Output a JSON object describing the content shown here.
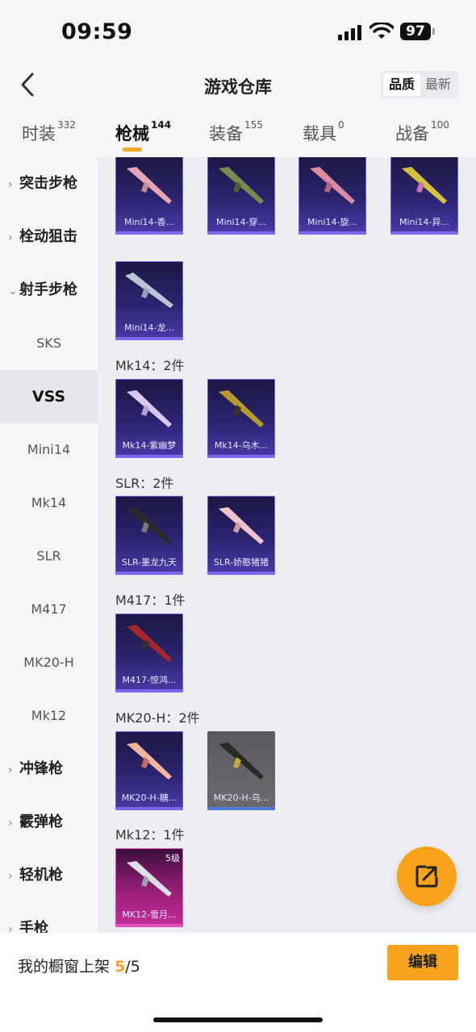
{
  "status_bar": {
    "time": "09:59",
    "battery": "97"
  },
  "header": {
    "title": "游戏仓库",
    "sort_options": [
      "品质",
      "最新"
    ],
    "sort_selected": "品质"
  },
  "tabs": [
    {
      "label": "时装",
      "count": "332"
    },
    {
      "label": "枪械",
      "count": "144",
      "active": true
    },
    {
      "label": "装备",
      "count": "155"
    },
    {
      "label": "载具",
      "count": "0"
    },
    {
      "label": "战备",
      "count": "100"
    }
  ],
  "sidebar": {
    "items": [
      {
        "label": "突击步枪",
        "type": "category",
        "expanded": false
      },
      {
        "label": "栓动狙击",
        "type": "category",
        "expanded": false
      },
      {
        "label": "射手步枪",
        "type": "category",
        "expanded": true
      },
      {
        "label": "SKS",
        "type": "sub"
      },
      {
        "label": "VSS",
        "type": "sub",
        "active": true
      },
      {
        "label": "Mini14",
        "type": "sub"
      },
      {
        "label": "Mk14",
        "type": "sub"
      },
      {
        "label": "SLR",
        "type": "sub"
      },
      {
        "label": "M417",
        "type": "sub"
      },
      {
        "label": "MK20-H",
        "type": "sub"
      },
      {
        "label": "Mk12",
        "type": "sub"
      },
      {
        "label": "冲锋枪",
        "type": "category",
        "expanded": false
      },
      {
        "label": "霰弹枪",
        "type": "category",
        "expanded": false
      },
      {
        "label": "轻机枪",
        "type": "category",
        "expanded": false
      },
      {
        "label": "手枪",
        "type": "category",
        "expanded": false
      }
    ]
  },
  "groups": {
    "mini14": {
      "items": [
        "Mini14-香...",
        "Mini14-穿...",
        "Mini14-旋...",
        "Mini14-异...",
        "Mini14-龙..."
      ]
    },
    "mk14": {
      "label": "Mk14：2件",
      "items": [
        "Mk14-紫幽梦",
        "Mk14-乌木..."
      ]
    },
    "slr": {
      "label": "SLR：2件",
      "items": [
        "SLR-墨龙九天",
        "SLR-娇憨猪猪"
      ]
    },
    "m417": {
      "label": "M417：1件",
      "items": [
        "M417-惊鸿..."
      ]
    },
    "mk20h": {
      "label": "MK20-H：2件",
      "items": [
        "MK20-H-糖...",
        "MK20-H-乌..."
      ]
    },
    "mk12": {
      "label": "Mk12：1件",
      "items": [
        "MK12-雪月..."
      ],
      "level": "5级"
    }
  },
  "bottom": {
    "shelf_label": "我的橱窗上架",
    "shelf_count": "5",
    "shelf_total": "/5",
    "edit_label": "编辑"
  },
  "colors": {
    "accent": "#f7a21b",
    "purple_card": "#2b2470",
    "pink_card": "#c42d9a"
  }
}
